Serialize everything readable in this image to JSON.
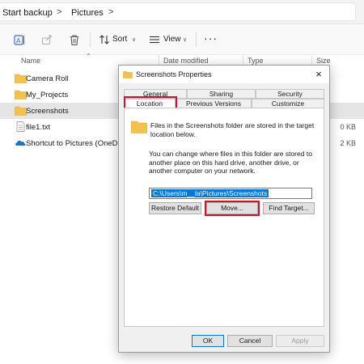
{
  "breadcrumb": {
    "items": [
      "Start backup",
      "Pictures"
    ]
  },
  "toolbar": {
    "sort": "Sort",
    "view": "View"
  },
  "columns": {
    "name": "Name",
    "date_modified": "Date modified",
    "type": "Type",
    "size": "Size"
  },
  "files": [
    {
      "name": "Camera Roll",
      "size": "",
      "kind": "folder"
    },
    {
      "name": "My_Projects",
      "size": "",
      "kind": "folder"
    },
    {
      "name": "Screenshots",
      "size": "",
      "kind": "folder",
      "selected": true
    },
    {
      "name": "file1.txt",
      "size": "0 KB",
      "kind": "text"
    },
    {
      "name": "Shortcut to Pictures (OneDrive",
      "size": "2 KB",
      "kind": "shortcut"
    }
  ],
  "dialog": {
    "title": "Screenshots Properties",
    "tabs_row1": [
      "General",
      "Sharing",
      "Security"
    ],
    "tabs_row2": [
      "Location",
      "Previous Versions",
      "Customize"
    ],
    "text1": "Files in the Screenshots folder are stored in the target location below.",
    "text2": "You can change where files in this folder are stored to another place on this hard drive, another drive, or another computer on your network.",
    "path": "C:\\Users\\m__la\\Pictures\\Screenshots",
    "buttons": {
      "restore": "Restore Default",
      "move": "Move...",
      "find": "Find Target..."
    },
    "footer": {
      "ok": "OK",
      "cancel": "Cancel",
      "apply": "Apply"
    }
  },
  "colors": {
    "highlight": "#c8142d",
    "selection": "#0078d7",
    "folder": "#f2c14e"
  }
}
